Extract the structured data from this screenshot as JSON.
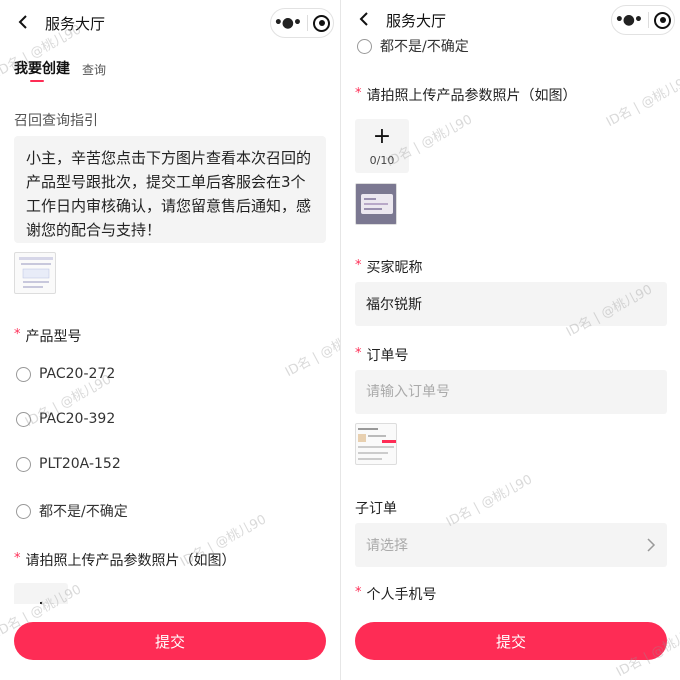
{
  "left": {
    "nav": {
      "title": "服务大厅",
      "back_icon": "chevron-left-icon",
      "more_icon": "more-dots-icon",
      "close_icon": "target-circle-icon"
    },
    "tabs": [
      {
        "label": "我要创建",
        "active": true
      },
      {
        "label": "查询",
        "active": false
      }
    ],
    "guide": {
      "title": "召回查询指引",
      "text": "小主，辛苦您点击下方图片查看本次召回的产品型号跟批次，提交工单后客服会在3个工作日内审核确认，请您留意售后通知，感谢您的配合与支持！"
    },
    "model": {
      "label": "产品型号",
      "options": [
        "PAC20-272",
        "PAC20-392",
        "PLT20A-152",
        "都不是/不确定"
      ]
    },
    "upload": {
      "label": "请拍照上传产品参数照片（如图）"
    },
    "submit_label": "提交"
  },
  "right": {
    "nav": {
      "title": "服务大厅"
    },
    "top_option": "都不是/不确定",
    "upload": {
      "label": "请拍照上传产品参数照片（如图）",
      "count": "0/10"
    },
    "nickname": {
      "label": "买家昵称",
      "value": "福尔锐斯"
    },
    "order": {
      "label": "订单号",
      "placeholder": "请输入订单号"
    },
    "suborder": {
      "label": "子订单",
      "placeholder": "请选择"
    },
    "phone": {
      "label": "个人手机号"
    },
    "submit_label": "提交"
  },
  "watermark": "ID名 | @桃儿90",
  "colors": {
    "accent": "#fe2c55",
    "field_bg": "#f4f4f4"
  }
}
